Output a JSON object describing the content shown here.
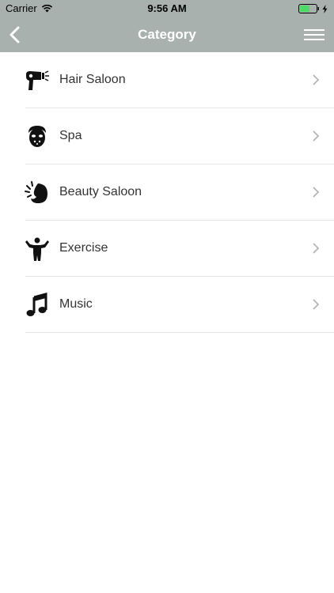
{
  "status_bar": {
    "carrier": "Carrier",
    "time": "9:56 AM",
    "battery_color": "#4cd964"
  },
  "nav": {
    "title": "Category",
    "back_icon": "chevron-left-icon",
    "menu_icon": "hamburger-menu-icon",
    "background": "#a8b1ae"
  },
  "categories": [
    {
      "label": "Hair Saloon",
      "icon": "hair-dryer-icon"
    },
    {
      "label": "Spa",
      "icon": "spa-face-icon"
    },
    {
      "label": "Beauty Saloon",
      "icon": "beauty-face-icon"
    },
    {
      "label": "Exercise",
      "icon": "exercise-person-icon"
    },
    {
      "label": "Music",
      "icon": "music-note-icon"
    }
  ]
}
